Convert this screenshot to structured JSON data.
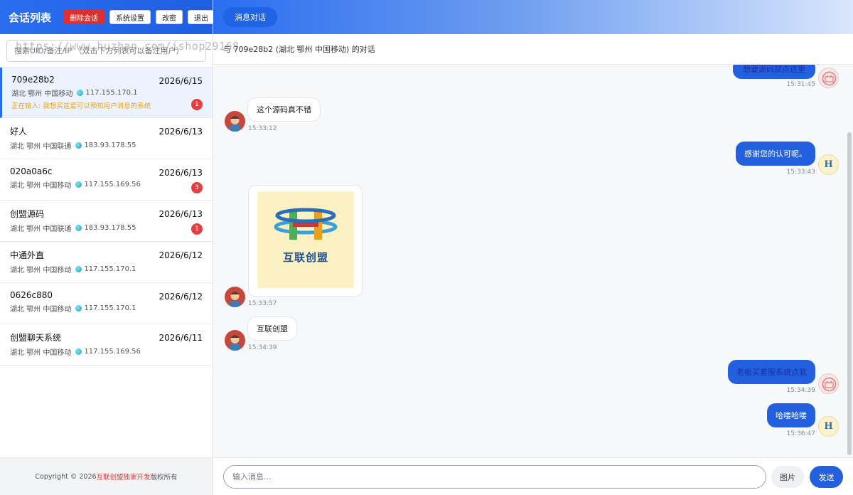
{
  "sidebar": {
    "title": "会话列表",
    "buttons": {
      "delete": "删除会话",
      "settings": "系统设置",
      "change_password": "改密",
      "logout": "退出"
    },
    "search_placeholder": "搜索UID/备注/IP （双击下方列表可以备注用户）",
    "sessions": [
      {
        "name": "709e28b2",
        "date": "2026/6/15",
        "location": "湖北 鄂州 中国移动",
        "ip": "117.155.170.1",
        "typing": "正在输入: 我想买这套可以预知用户消息的系统",
        "unread": "1"
      },
      {
        "name": "好人",
        "date": "2026/6/13",
        "location": "湖北 鄂州 中国联通",
        "ip": "183.93.178.55"
      },
      {
        "name": "020a0a6c",
        "date": "2026/6/13",
        "location": "湖北 鄂州 中国移动",
        "ip": "117.155.169.56",
        "unread": "3"
      },
      {
        "name": "创盟源码",
        "date": "2026/6/13",
        "location": "湖北 鄂州 中国联通",
        "ip": "183.93.178.55",
        "unread": "1"
      },
      {
        "name": "中通外直",
        "date": "2026/6/12",
        "location": "湖北 鄂州 中国移动",
        "ip": "117.155.170.1"
      },
      {
        "name": "0626c880",
        "date": "2026/6/12",
        "location": "湖北 鄂州 中国移动",
        "ip": "117.155.170.1"
      },
      {
        "name": "创盟聊天系统",
        "date": "2026/6/11",
        "location": "湖北 鄂州 中国移动",
        "ip": "117.155.169.56"
      }
    ],
    "footer": {
      "prefix": "Copyright © 2026 ",
      "brand": "互联创盟独家开发",
      "suffix": " 版权所有"
    }
  },
  "chat": {
    "tab": "消息对话",
    "conversation_title": "与 709e28b2 (湖北 鄂州 中国移动) 的对话",
    "messages": [
      {
        "dir": "out",
        "text": "想要源码就点这里",
        "time": "15:31:45"
      },
      {
        "dir": "in",
        "text": "这个源码真不错",
        "time": "15:33:12"
      },
      {
        "dir": "out",
        "text": "感谢您的认可呢。",
        "time": "15:33:43"
      },
      {
        "dir": "in",
        "type": "image",
        "image_caption": "互联创盟",
        "time": "15:33:57"
      },
      {
        "dir": "in",
        "text": "互联创盟",
        "time": "15:34:39"
      },
      {
        "dir": "out",
        "text": "老板买套服系统点我",
        "time": "15:34:39"
      },
      {
        "dir": "out",
        "text": "哈喽哈喽",
        "time": "15:36:47"
      }
    ],
    "input_placeholder": "输入消息...",
    "image_button": "图片",
    "send_button": "发送"
  },
  "watermark": "https://www.huzhan.com/ishop29168",
  "colors": {
    "primary": "#2a6df0",
    "danger": "#e02d2d",
    "badge": "#e53e3e",
    "typing": "#e8a317"
  }
}
